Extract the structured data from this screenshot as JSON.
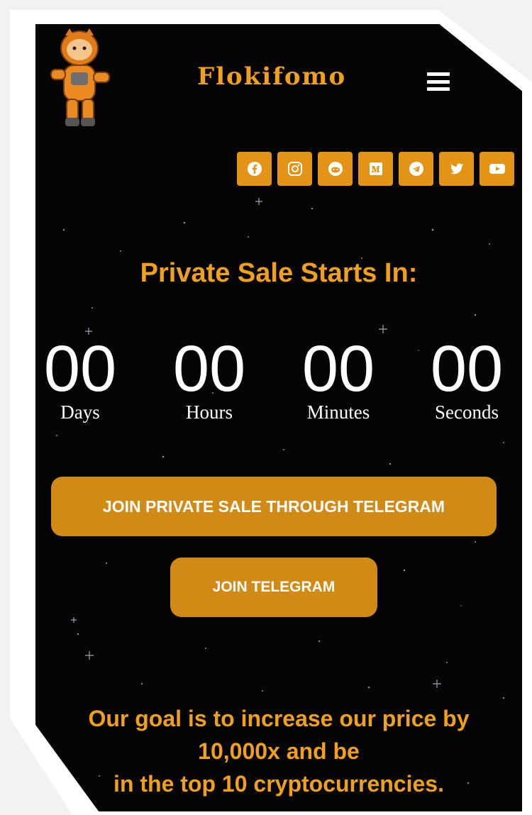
{
  "header": {
    "brand": "Flokifomo",
    "menu_icon": "hamburger-menu-icon"
  },
  "socials": [
    {
      "icon": "facebook-icon"
    },
    {
      "icon": "instagram-icon"
    },
    {
      "icon": "reddit-icon"
    },
    {
      "icon": "medium-icon"
    },
    {
      "icon": "telegram-icon"
    },
    {
      "icon": "twitter-icon"
    },
    {
      "icon": "youtube-icon"
    }
  ],
  "countdown": {
    "title": "Private Sale Starts In:",
    "units": [
      {
        "value": "00",
        "label": "Days"
      },
      {
        "value": "00",
        "label": "Hours"
      },
      {
        "value": "00",
        "label": "Minutes"
      },
      {
        "value": "00",
        "label": "Seconds"
      }
    ]
  },
  "buttons": {
    "private_sale": "JOIN PRIVATE SALE THROUGH TELEGRAM",
    "telegram": "JOIN TELEGRAM"
  },
  "goal": {
    "line1": "Our goal is to increase our price by",
    "line2": "10,000x and be",
    "line3": "in the top 10 cryptocurrencies."
  },
  "colors": {
    "accent": "#f1a01c",
    "button": "#d18a16",
    "background": "#050505"
  }
}
